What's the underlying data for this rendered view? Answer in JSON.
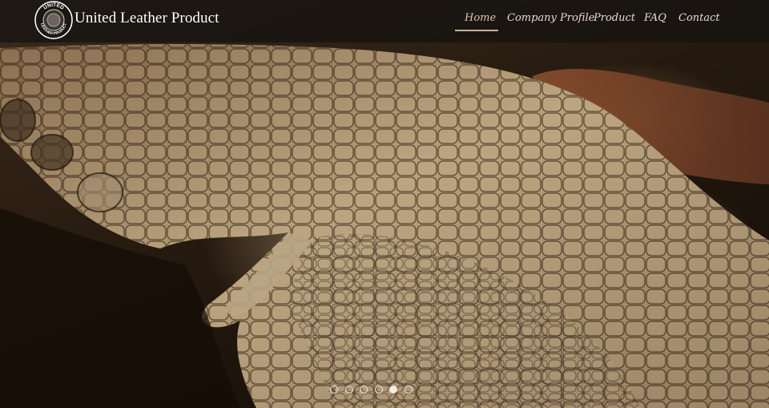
{
  "brand": {
    "logo_text": "UNITED LEATHER PRODUCT",
    "name": "United Leather Product"
  },
  "nav": {
    "items": [
      {
        "label": "Home"
      },
      {
        "label": "Company Profile"
      },
      {
        "label": "Product"
      },
      {
        "label": "FAQ"
      },
      {
        "label": "Contact"
      }
    ],
    "active": "Home"
  },
  "hero": {
    "image": "crocodile-leather-hide-photo"
  },
  "carousel": {
    "slide_count": 6,
    "current_slide": 5
  },
  "colors": {
    "nav_text": "#e6dccd",
    "active_underline": "#c8b699",
    "brand_text": "#ffffff"
  }
}
